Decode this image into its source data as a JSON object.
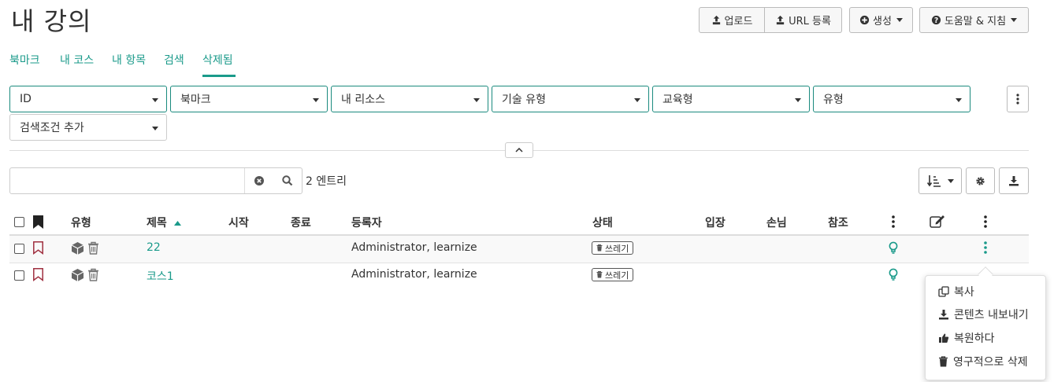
{
  "page_title": "내 강의",
  "header_buttons": {
    "upload": "업로드",
    "url_register": "URL 등록",
    "create": "생성",
    "help": "도움말 & 지침"
  },
  "tabs": [
    "북마크",
    "내 코스",
    "내 항목",
    "검색",
    "삭제됨"
  ],
  "active_tab": "삭제됨",
  "filters": [
    "ID",
    "북마크",
    "내 리소스",
    "기술 유형",
    "교육형",
    "유형"
  ],
  "add_filter": "검색조건 추가",
  "search": {
    "value": "",
    "placeholder": ""
  },
  "entry_count": "2 엔트리",
  "columns": {
    "type": "유형",
    "title": "제목",
    "start": "시작",
    "end": "종료",
    "registrant": "등록자",
    "status": "상태",
    "entry": "입장",
    "guest": "손님",
    "reference": "참조"
  },
  "rows": [
    {
      "title": "22",
      "registrant": "Administrator, learnize",
      "status": "쓰레기"
    },
    {
      "title": "코스1",
      "registrant": "Administrator, learnize",
      "status": "쓰레기"
    }
  ],
  "context_menu": {
    "copy": "복사",
    "export": "콘텐츠 내보내기",
    "restore": "복원하다",
    "delete_forever": "영구적으로 삭제"
  },
  "colors": {
    "accent": "#1a9a8a",
    "bookmark": "#a03040"
  }
}
